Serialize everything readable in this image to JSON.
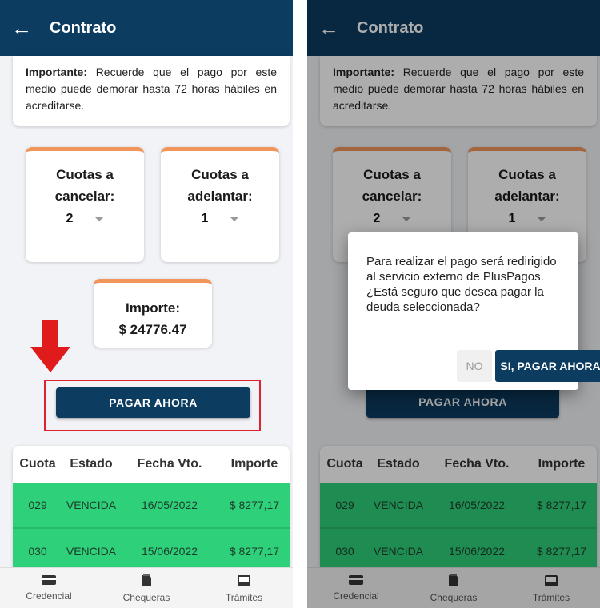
{
  "colors": {
    "appbar": "#0d3c61",
    "card_accent": "#f2955a",
    "paid_row": "#2fd07a",
    "annotation_red": "#e01b1b"
  },
  "screen_left": {
    "appbar": {
      "back_icon": "arrow-left-icon",
      "title": "Contrato"
    },
    "notice": {
      "bold": "Importante:",
      "text": " Recuerde que el pago por este medio puede demorar hasta 72 horas hábiles en acreditarse."
    },
    "cuotas_cancelar": {
      "title_line1": "Cuotas a",
      "title_line2": "cancelar:",
      "value": "2"
    },
    "cuotas_adelantar": {
      "title_line1": "Cuotas a",
      "title_line2": "adelantar:",
      "value": "1"
    },
    "importe": {
      "title": "Importe:",
      "amount": "$ 24776.47"
    },
    "pay_button": "PAGAR AHORA",
    "table": {
      "headers": [
        "Cuota",
        "Estado",
        "Fecha Vto.",
        "Importe"
      ],
      "rows": [
        [
          "029",
          "VENCIDA",
          "16/05/2022",
          "$ 8277,17"
        ],
        [
          "030",
          "VENCIDA",
          "15/06/2022",
          "$ 8277,17"
        ]
      ]
    },
    "nav": [
      {
        "icon": "id-card-icon",
        "label": "Credencial"
      },
      {
        "icon": "checkbook-icon",
        "label": "Chequeras"
      },
      {
        "icon": "inbox-icon",
        "label": "Trámites"
      }
    ]
  },
  "screen_right": {
    "appbar": {
      "back_icon": "arrow-left-icon",
      "title": "Contrato"
    },
    "notice": {
      "bold": "Importante:",
      "text": " Recuerde que el pago por este medio puede demorar hasta 72 horas hábiles en acreditarse."
    },
    "cuotas_cancelar": {
      "title_line1": "Cuotas a",
      "title_line2": "cancelar:",
      "value": "2"
    },
    "cuotas_adelantar": {
      "title_line1": "Cuotas a",
      "title_line2": "adelantar:",
      "value": "1"
    },
    "pay_button": "PAGAR AHORA",
    "table": {
      "headers": [
        "Cuota",
        "Estado",
        "Fecha Vto.",
        "Importe"
      ],
      "rows": [
        [
          "029",
          "VENCIDA",
          "16/05/2022",
          "$ 8277,17"
        ],
        [
          "030",
          "VENCIDA",
          "15/06/2022",
          "$ 8277,17"
        ]
      ]
    },
    "nav": [
      {
        "icon": "id-card-icon",
        "label": "Credencial"
      },
      {
        "icon": "checkbook-icon",
        "label": "Chequeras"
      },
      {
        "icon": "inbox-icon",
        "label": "Trámites"
      }
    ],
    "dialog": {
      "message": "Para realizar el pago será redirigido al servicio externo de PlusPagos. ¿Está seguro que desea pagar la deuda seleccionada?",
      "no_button": "NO",
      "yes_button": "SI, PAGAR AHORA"
    }
  }
}
